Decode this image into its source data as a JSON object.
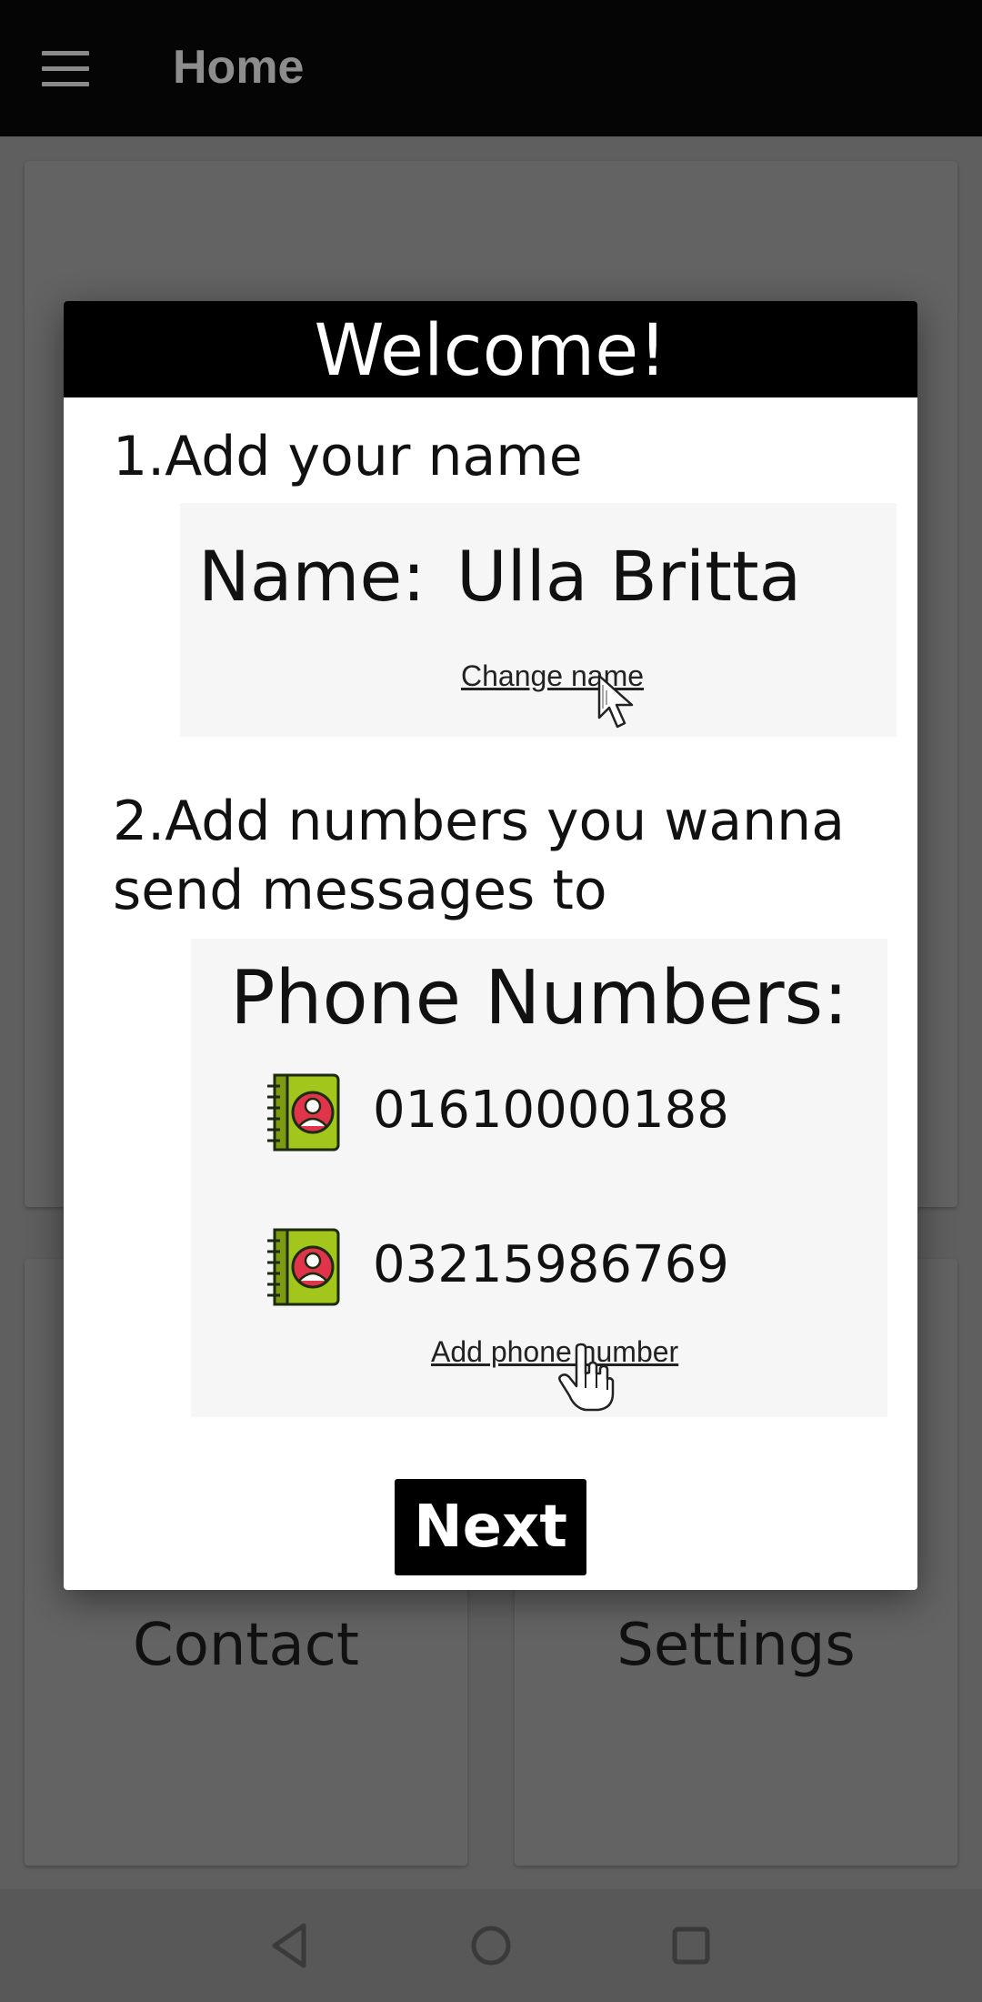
{
  "app": {
    "title": "Home"
  },
  "cards": [
    {
      "label": ""
    },
    {
      "label": ""
    },
    {
      "label": "Contact"
    },
    {
      "label": "Settings"
    }
  ],
  "dialog": {
    "title": "Welcome!",
    "step1": "1.Add your name",
    "name_label": "Name:",
    "name_value": "Ulla Britta",
    "change_name_link": "Change name",
    "step2_line1": "2.Add numbers you wanna",
    "step2_line2": "send messages to",
    "phone_title": "Phone Numbers:",
    "phones": [
      {
        "number": "01610000188"
      },
      {
        "number": "03215986769"
      }
    ],
    "add_phone_link": "Add phone number",
    "next_button": "Next"
  },
  "colors": {
    "accent_green": "#a3c61d",
    "contact_red": "#e1344a",
    "header_black": "#000000"
  },
  "icons": [
    "menu-icon",
    "address-book-icon",
    "arrow-cursor-icon",
    "hand-cursor-icon",
    "back-icon",
    "home-icon",
    "recents-icon"
  ]
}
